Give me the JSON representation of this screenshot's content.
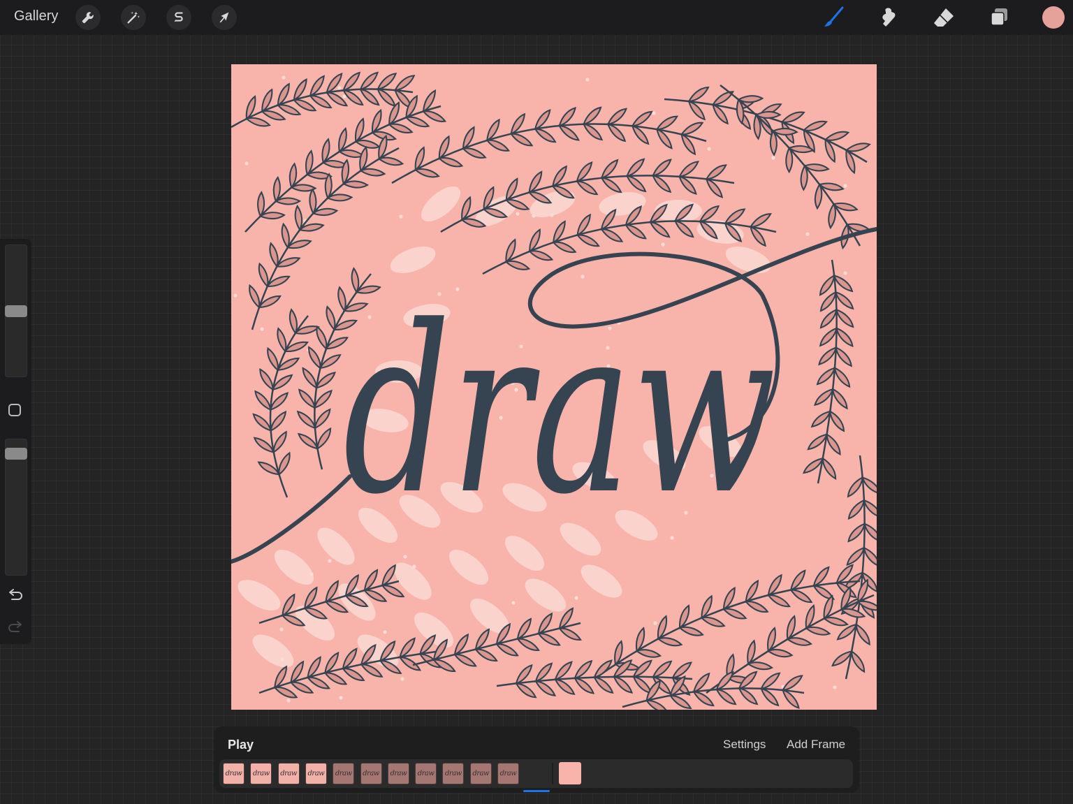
{
  "toolbar": {
    "gallery_label": "Gallery",
    "left_tools": [
      {
        "name": "actions",
        "icon": "wrench-icon"
      },
      {
        "name": "adjustments",
        "icon": "magic-wand-icon"
      },
      {
        "name": "selection",
        "icon": "selection-s-icon"
      },
      {
        "name": "transform",
        "icon": "arrow-cursor-icon"
      }
    ],
    "right_tools": [
      {
        "name": "brush",
        "icon": "brush-icon",
        "active": true
      },
      {
        "name": "smudge",
        "icon": "smudge-icon",
        "active": false
      },
      {
        "name": "eraser",
        "icon": "eraser-icon",
        "active": false
      },
      {
        "name": "layers",
        "icon": "layers-icon",
        "active": false
      }
    ],
    "current_color": "#e5a29a",
    "accent_color": "#1f73e6"
  },
  "sidebar": {
    "brush_size_level": 0.5,
    "opacity_level": 0.93,
    "modify_icon": "square-icon",
    "undo_icon": "undo-icon",
    "redo_icon": "redo-icon"
  },
  "canvas": {
    "artwork_text": "draw",
    "background_color": "#f8b4aa",
    "ink_color": "#364350",
    "leaf_fill": "#d9968f",
    "pale_leaf": "#fbd3cd"
  },
  "animation": {
    "play_label": "Play",
    "settings_label": "Settings",
    "add_frame_label": "Add Frame",
    "frames": [
      {
        "label": "draw",
        "shade": "#f1b0a8"
      },
      {
        "label": "draw",
        "shade": "#f1b0a8"
      },
      {
        "label": "draw",
        "shade": "#f1b0a8"
      },
      {
        "label": "draw",
        "shade": "#f1b0a8"
      },
      {
        "label": "draw",
        "shade": "#a47772"
      },
      {
        "label": "draw",
        "shade": "#a47772"
      },
      {
        "label": "draw",
        "shade": "#a47772"
      },
      {
        "label": "draw",
        "shade": "#a47772"
      },
      {
        "label": "draw",
        "shade": "#a47772"
      },
      {
        "label": "draw",
        "shade": "#a47772"
      },
      {
        "label": "draw",
        "shade": "#a47772"
      }
    ],
    "selected_frame": 11
  }
}
